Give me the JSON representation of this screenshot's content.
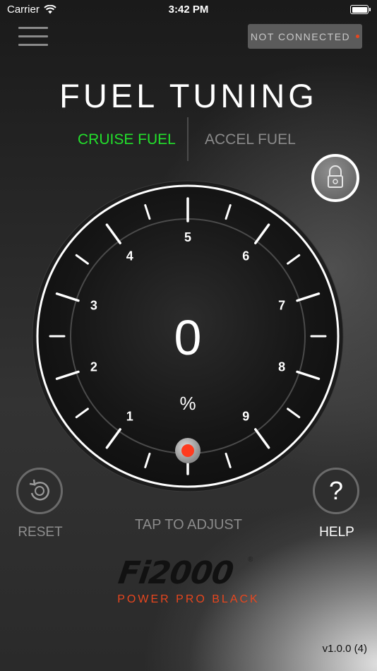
{
  "status_bar": {
    "carrier": "Carrier",
    "time": "3:42 PM"
  },
  "connection": {
    "label": "NOT CONNECTED",
    "status_color": "#e8461e"
  },
  "title": "FUEL TUNING",
  "tabs": [
    {
      "label": "CRUISE FUEL",
      "active": true,
      "color": "#23e02c"
    },
    {
      "label": "ACCEL FUEL",
      "active": false,
      "color": "#8a8a8a"
    }
  ],
  "dial": {
    "value": "0",
    "unit": "%",
    "tick_labels": [
      "1",
      "2",
      "3",
      "4",
      "5",
      "6",
      "7",
      "8",
      "9"
    ],
    "indicator_color": "#ff3b1f",
    "level": 0
  },
  "tap_label": "TAP TO ADJUST",
  "reset_label": "RESET",
  "help_label": "HELP",
  "help_glyph": "?",
  "logo": {
    "brand": "Fi2000",
    "registered": "®",
    "tagline": "POWER PRO BLACK"
  },
  "version": "v1.0.0 (4)",
  "icons": {
    "menu": "hamburger-icon",
    "lock": "lock-icon",
    "reset": "reset-icon",
    "wifi": "wifi-icon",
    "battery": "battery-icon"
  }
}
